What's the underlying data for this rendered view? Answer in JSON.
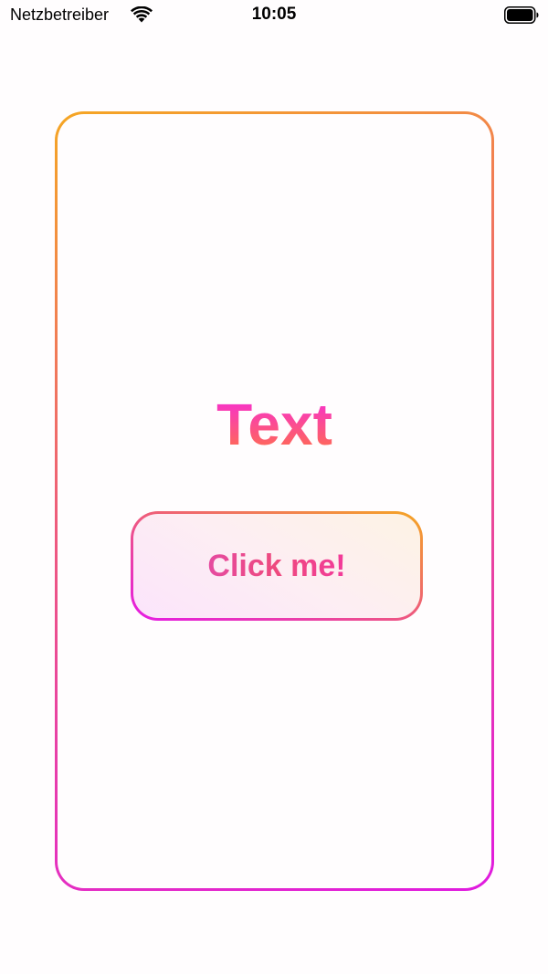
{
  "status_bar": {
    "carrier": "Netzbetreiber",
    "time": "10:05",
    "wifi_icon": "wifi-icon",
    "battery_icon": "battery-full-icon"
  },
  "card": {
    "title": "Text",
    "button_label": "Click me!"
  },
  "colors": {
    "gradient_orange": "#f5a623",
    "gradient_pink": "#ee5a7e",
    "gradient_magenta": "#e01ae0",
    "background": "#fffdfe"
  }
}
